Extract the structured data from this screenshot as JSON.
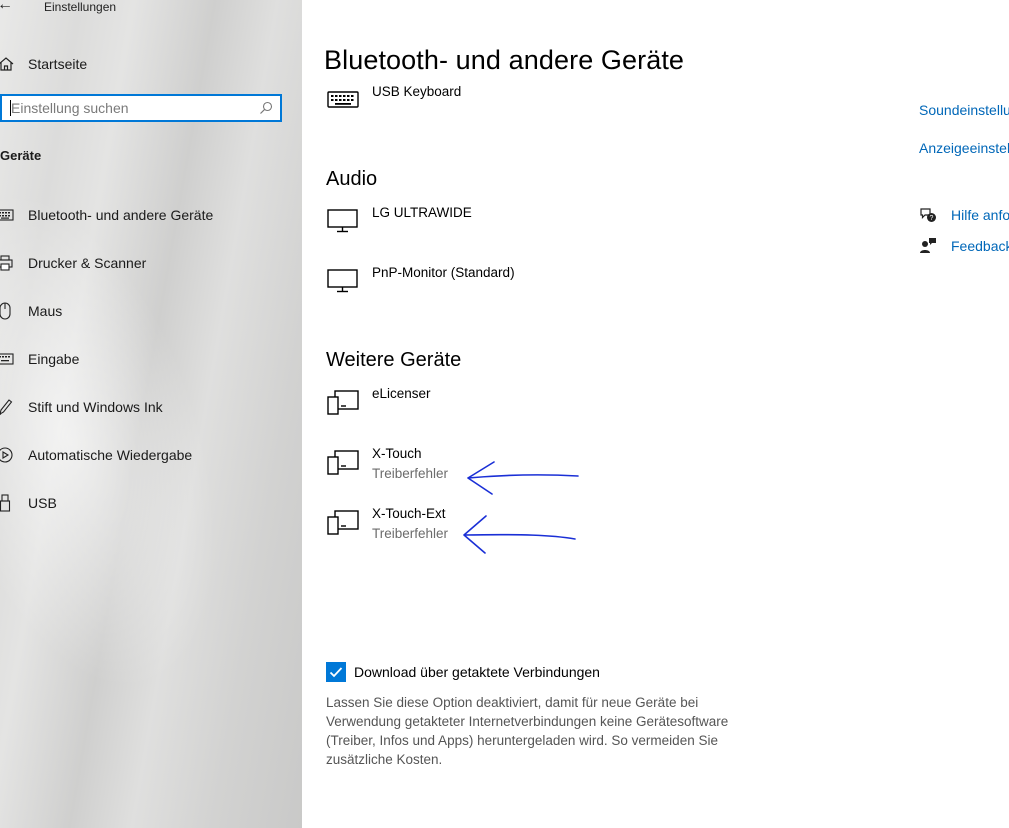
{
  "window": {
    "title": "Einstellungen"
  },
  "sidebar": {
    "home_label": "Startseite",
    "search_placeholder": "Einstellung suchen",
    "section_title": "Geräte",
    "items": [
      {
        "label": "Bluetooth- und andere Geräte",
        "icon": "keyboard-icon"
      },
      {
        "label": "Drucker & Scanner",
        "icon": "printer-icon"
      },
      {
        "label": "Maus",
        "icon": "mouse-icon"
      },
      {
        "label": "Eingabe",
        "icon": "keyboard-icon"
      },
      {
        "label": "Stift und Windows Ink",
        "icon": "pen-icon"
      },
      {
        "label": "Automatische Wiedergabe",
        "icon": "autoplay-icon"
      },
      {
        "label": "USB",
        "icon": "usb-icon"
      }
    ]
  },
  "main": {
    "title": "Bluetooth- und andere Geräte",
    "keyboard_device": {
      "name": "USB Keyboard"
    },
    "audio": {
      "heading": "Audio",
      "devices": [
        {
          "name": "LG ULTRAWIDE"
        },
        {
          "name": "PnP-Monitor (Standard)"
        }
      ]
    },
    "other": {
      "heading": "Weitere Geräte",
      "devices": [
        {
          "name": "eLicenser",
          "status": ""
        },
        {
          "name": "X-Touch",
          "status": "Treiberfehler"
        },
        {
          "name": "X-Touch-Ext",
          "status": "Treiberfehler"
        }
      ]
    },
    "metered": {
      "checked": true,
      "label": "Download über getaktete Verbindungen",
      "description": "Lassen Sie diese Option deaktiviert, damit für neue Geräte bei Verwendung getakteter Internetverbindungen keine Gerätesoftware (Treiber, Infos und Apps) heruntergeladen wird. So vermeiden Sie zusätzliche Kosten."
    }
  },
  "related": {
    "links": [
      "Soundeinstellu",
      "Anzeigeeinstel"
    ],
    "help": {
      "label": "Hilfe anfo",
      "icon": "help-chat-icon"
    },
    "feedback": {
      "label": "Feedback",
      "icon": "feedback-icon"
    }
  },
  "colors": {
    "accent": "#0078d7",
    "link": "#0067b8",
    "annotation": "#1a2fd6"
  }
}
